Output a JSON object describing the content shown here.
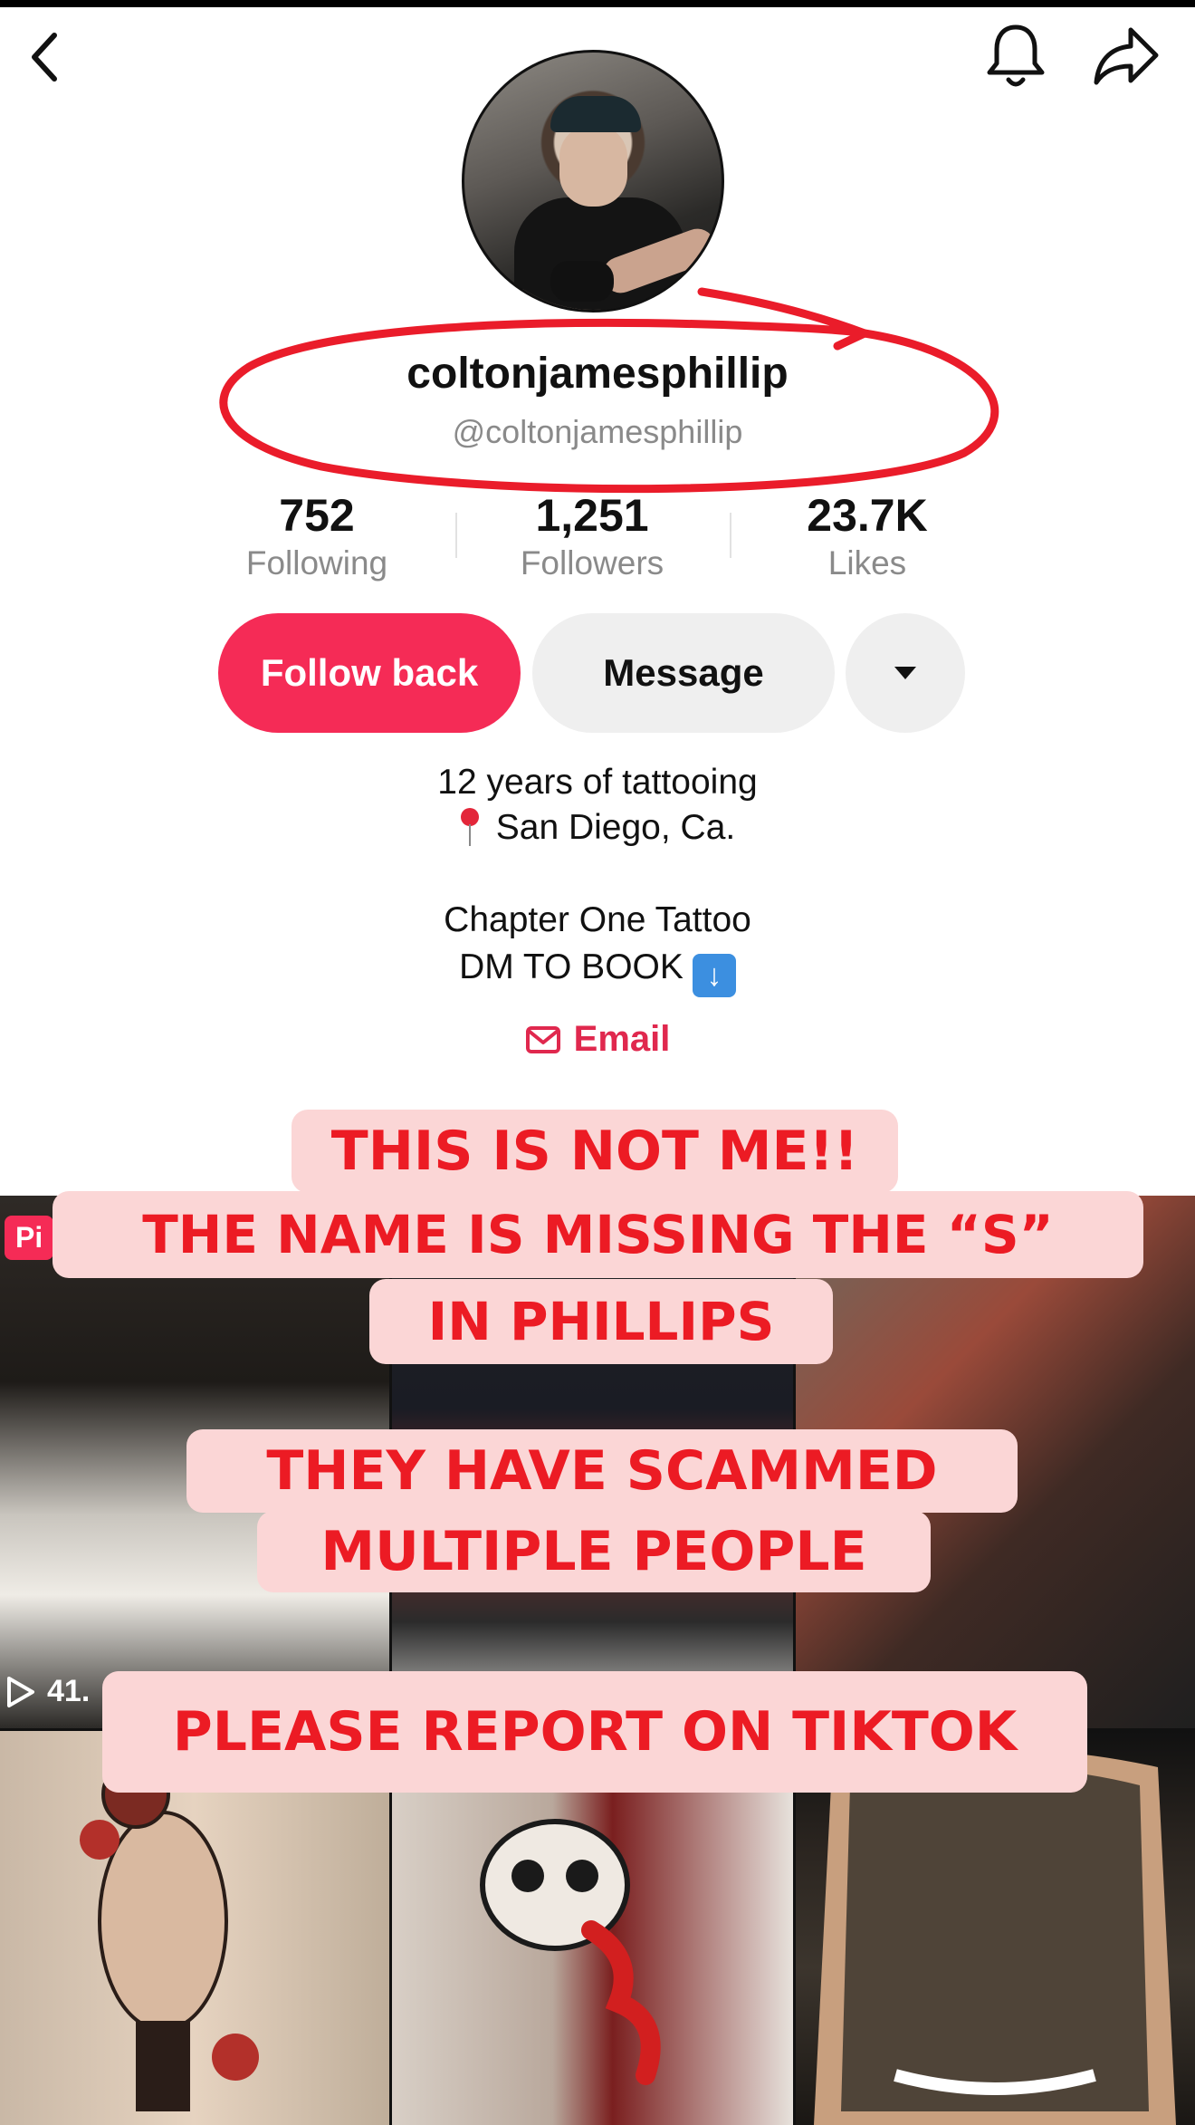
{
  "profile": {
    "display_name": "coltonjamesphillip",
    "handle": "@coltonjamesphillip"
  },
  "stats": [
    {
      "value": "752",
      "label": "Following"
    },
    {
      "value": "1,251",
      "label": "Followers"
    },
    {
      "value": "23.7K",
      "label": "Likes"
    }
  ],
  "actions": {
    "follow_back": "Follow back",
    "message": "Message"
  },
  "bio": {
    "line1": "12 years of tattooing",
    "line2": "San Diego, Ca.",
    "line3": "Chapter One Tattoo",
    "line4": "DM TO BOOK"
  },
  "email_label": "Email",
  "grid": {
    "pinned_badge": "Pi",
    "views": "41."
  },
  "overlay": {
    "line1": "THIS IS NOT ME!!",
    "line2": "THE NAME IS MISSING THE “S”",
    "line3": "IN PHILLIPS",
    "line4": "THEY HAVE SCAMMED",
    "line5": "MULTIPLE PEOPLE",
    "line6": "PLEASE REPORT ON TIKTOK"
  },
  "colors": {
    "accent": "#f52b56",
    "annotation_red": "#ec1b24",
    "overlay_bg": "#fbd6d6"
  },
  "icons": [
    "back-icon",
    "bell-icon",
    "share-icon",
    "dropdown-icon",
    "pin-icon",
    "down-arrow-icon",
    "mail-icon",
    "play-icon"
  ]
}
